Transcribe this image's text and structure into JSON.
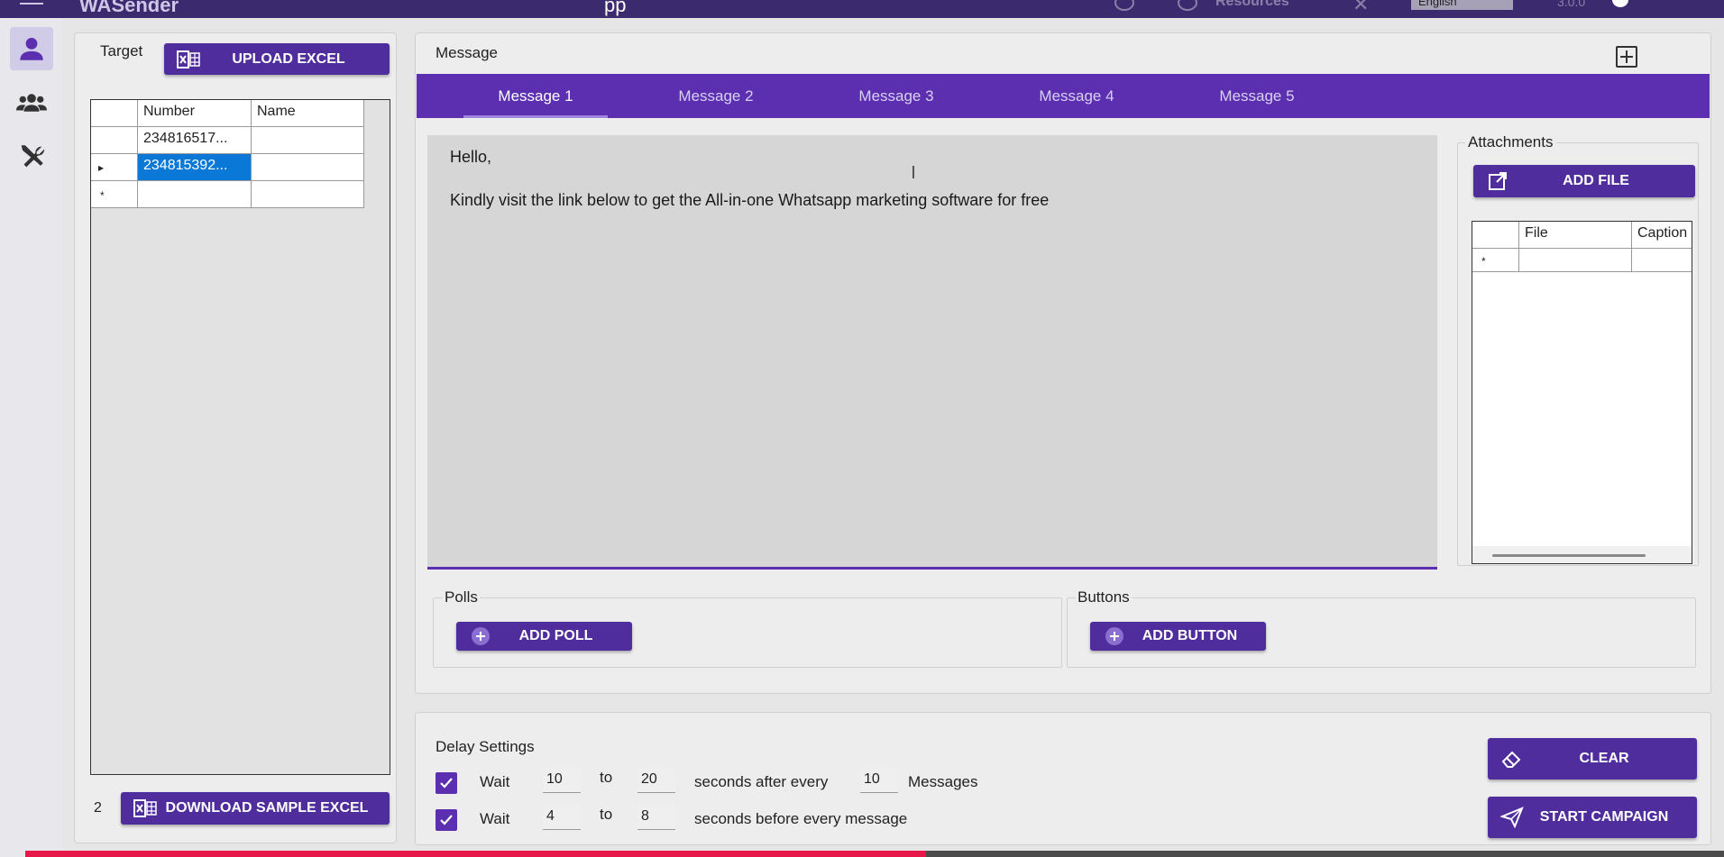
{
  "app": {
    "title": "WASender",
    "center_title": "pp",
    "status_text": "Resources",
    "language": "English",
    "version": "3.0.0"
  },
  "sidebar": {
    "items": [
      {
        "name": "single-sender",
        "icon": "user-icon",
        "active": true
      },
      {
        "name": "group-sender",
        "icon": "users-icon",
        "active": false
      },
      {
        "name": "tools",
        "icon": "tools-icon",
        "active": false
      }
    ]
  },
  "target": {
    "label": "Target",
    "upload_button": "UPLOAD EXCEL",
    "columns": [
      "Number",
      "Name"
    ],
    "rows": [
      {
        "indicator": "",
        "number": "234816517...",
        "name": ""
      },
      {
        "indicator": "▸",
        "number": "234815392...",
        "name": ""
      },
      {
        "indicator": "*",
        "number": "",
        "name": ""
      }
    ],
    "count": "2",
    "download_button": "DOWNLOAD SAMPLE EXCEL"
  },
  "message": {
    "label": "Message",
    "tabs": [
      "Message 1",
      "Message 2",
      "Message 3",
      "Message 4",
      "Message 5"
    ],
    "active_tab": 0,
    "body_lines": [
      "Hello,",
      "Kindly visit the link below to get the All-in-one Whatsapp marketing software for free"
    ]
  },
  "attachments": {
    "label": "Attachments",
    "add_button": "ADD FILE",
    "columns": [
      "File",
      "Caption"
    ],
    "new_row_indicator": "*"
  },
  "polls": {
    "label": "Polls",
    "add_button": "ADD POLL"
  },
  "buttons_group": {
    "label": "Buttons",
    "add_button": "ADD BUTTON"
  },
  "delay": {
    "label": "Delay Settings",
    "row1": {
      "checked": true,
      "wait": "Wait",
      "min": "10",
      "to": "to",
      "max": "20",
      "after": "seconds after every",
      "count": "10",
      "unit": "Messages"
    },
    "row2": {
      "checked": true,
      "wait": "Wait",
      "min": "4",
      "to": "to",
      "max": "8",
      "after": "seconds before every message"
    }
  },
  "actions": {
    "clear": "CLEAR",
    "start": "START CAMPAIGN"
  },
  "video_progress": 0.53,
  "colors": {
    "accent": "#5b2fb0",
    "button": "#4f2d9c",
    "selection": "#0a78d7",
    "progress": "#e8174a"
  }
}
